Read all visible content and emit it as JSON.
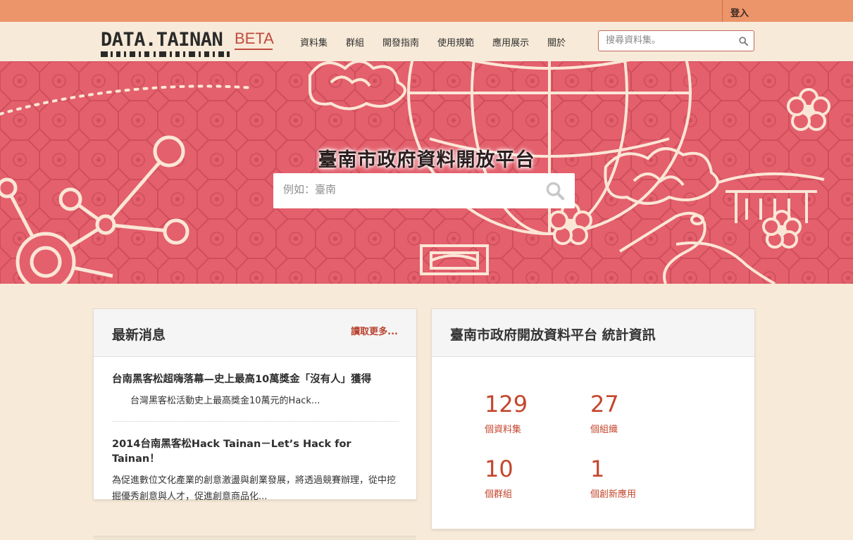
{
  "topbar": {
    "login_label": "登入"
  },
  "logo": {
    "main": "DATA.TAINAN",
    "beta": "BETA"
  },
  "nav": {
    "items": [
      {
        "label": "資料集"
      },
      {
        "label": "群組"
      },
      {
        "label": "開發指南"
      },
      {
        "label": "使用規範"
      },
      {
        "label": "應用展示"
      },
      {
        "label": "關於"
      }
    ],
    "search_placeholder": "搜尋資料集。"
  },
  "hero": {
    "title": "臺南市政府資料開放平台",
    "search_placeholder": "例如：臺南"
  },
  "news": {
    "title": "最新消息",
    "read_more": "讀取更多...",
    "items": [
      {
        "title": "台南黑客松超嗨落幕—史上最高10萬獎金「沒有人」獲得",
        "summary": "　　台灣黑客松活動史上最高獎金10萬元的Hack..."
      },
      {
        "title": "2014台南黑客松Hack Tainan－Let’s Hack for Tainan！",
        "summary": "為促進數位文化產業的創意激盪與創業發展，將透過競賽辦理，從中挖掘優秀創意與人才，促進創意商品化..."
      }
    ]
  },
  "stats": {
    "title": "臺南市政府開放資料平台 統計資訊",
    "items": [
      {
        "value": "129",
        "label": "個資料集"
      },
      {
        "value": "27",
        "label": "個組織"
      },
      {
        "value": "10",
        "label": "個群組"
      },
      {
        "value": "1",
        "label": "個創新應用"
      }
    ]
  },
  "colors": {
    "topbar": "#ec946a",
    "hero": "#e3606c",
    "accent": "#c4462d",
    "page_bg": "#f7ead8"
  },
  "icons": [
    "search-icon",
    "logo-barcode"
  ]
}
